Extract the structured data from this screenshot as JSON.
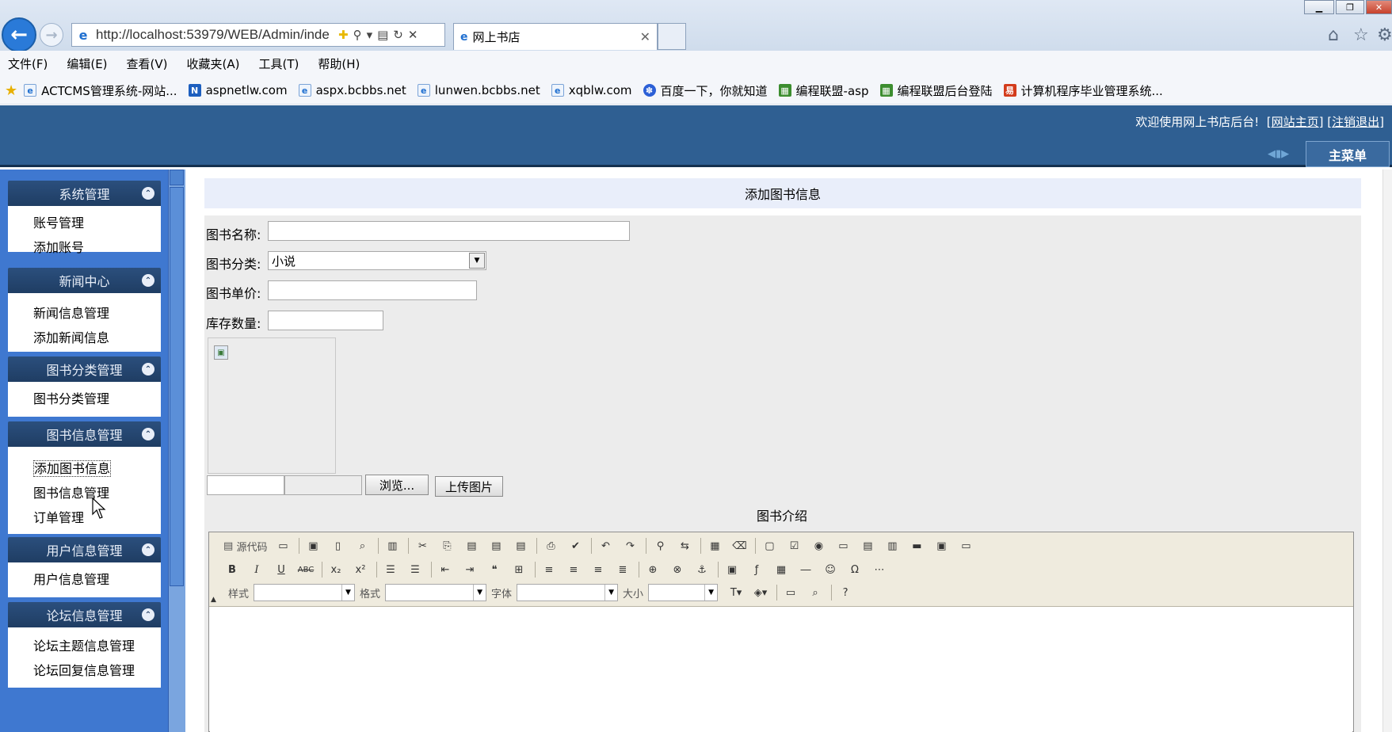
{
  "browser": {
    "url": "http://localhost:53979/WEB/Admin/inde",
    "tab_title": "网上书店",
    "menu": [
      "文件(F)",
      "编辑(E)",
      "查看(V)",
      "收藏夹(A)",
      "工具(T)",
      "帮助(H)"
    ],
    "favorites": [
      {
        "label": "ACTCMS管理系统-网站...",
        "icon": "ie-page-icon"
      },
      {
        "label": "aspnetlw.com",
        "icon": "blue-n-icon"
      },
      {
        "label": "aspx.bcbbs.net",
        "icon": "ie-page-icon"
      },
      {
        "label": "lunwen.bcbbs.net",
        "icon": "ie-page-icon"
      },
      {
        "label": "xqblw.com",
        "icon": "ie-page-icon"
      },
      {
        "label": "百度一下，你就知道",
        "icon": "baidu-paw-icon"
      },
      {
        "label": "编程联盟-asp",
        "icon": "green-grid-icon"
      },
      {
        "label": "编程联盟后台登陆",
        "icon": "green-grid-icon"
      },
      {
        "label": "计算机程序毕业管理系统...",
        "icon": "red-logo-icon"
      }
    ]
  },
  "header": {
    "welcome_text": "欢迎使用网上书店后台!",
    "home_link": "网站主页",
    "logout_link": "注销退出",
    "main_menu_tab": "主菜单",
    "color": "#2f5f92"
  },
  "sidebar": {
    "groups": [
      {
        "title": "系统管理",
        "items": [
          "账号管理",
          "添加账号"
        ]
      },
      {
        "title": "新闻中心",
        "items": [
          "新闻信息管理",
          "添加新闻信息"
        ]
      },
      {
        "title": "图书分类管理",
        "items": [
          "图书分类管理"
        ]
      },
      {
        "title": "图书信息管理",
        "items": [
          "添加图书信息",
          "图书信息管理",
          "订单管理"
        ]
      },
      {
        "title": "用户信息管理",
        "items": [
          "用户信息管理"
        ]
      },
      {
        "title": "论坛信息管理",
        "items": [
          "论坛主题信息管理",
          "论坛回复信息管理"
        ]
      }
    ]
  },
  "form": {
    "title": "添加图书信息",
    "name_label": "图书名称:",
    "name_value": "",
    "category_label": "图书分类:",
    "category_value": "小说",
    "price_label": "图书单价:",
    "price_value": "",
    "stock_label": "库存数量:",
    "stock_value": "",
    "browse_button": "浏览...",
    "upload_button": "上传图片",
    "intro_label": "图书介绍"
  },
  "editor": {
    "source_label": "源代码",
    "style_label": "样式",
    "format_label": "格式",
    "font_label": "字体",
    "size_label": "大小"
  }
}
